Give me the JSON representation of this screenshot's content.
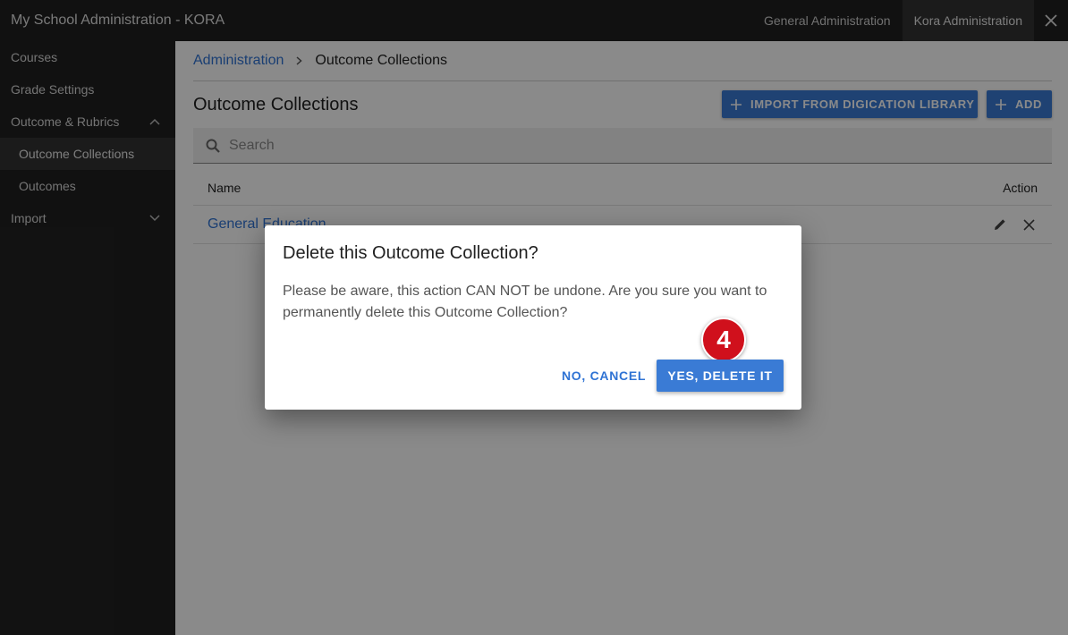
{
  "topbar": {
    "title": "My School Administration - KORA",
    "tabs": [
      {
        "label": "General Administration"
      },
      {
        "label": "Kora Administration"
      }
    ],
    "close_icon": "close-icon"
  },
  "sidebar": {
    "items": [
      {
        "label": "Courses"
      },
      {
        "label": "Grade Settings"
      },
      {
        "label": "Outcome & Rubrics",
        "icon": "chevron-up-icon"
      },
      {
        "label": "Outcome Collections"
      },
      {
        "label": "Outcomes"
      },
      {
        "label": "Import",
        "icon": "chevron-down-icon"
      }
    ]
  },
  "breadcrumb": {
    "root": "Administration",
    "current": "Outcome Collections"
  },
  "page": {
    "title": "Outcome Collections",
    "import_label": "IMPORT FROM DIGICATION LIBRARY",
    "add_label": "ADD"
  },
  "search": {
    "placeholder": "Search",
    "value": ""
  },
  "table": {
    "headers": {
      "name": "Name",
      "action": "Action"
    },
    "rows": [
      {
        "name": "General Education"
      }
    ]
  },
  "dialog": {
    "title": "Delete this Outcome Collection?",
    "body": "Please be aware, this action CAN NOT be undone. Are you sure you want to permanently delete this Outcome Collection?",
    "cancel_label": "NO, CANCEL",
    "confirm_label": "YES, DELETE IT",
    "step_number": "4"
  },
  "colors": {
    "accent": "#3a7bd5",
    "link": "#2f73d4",
    "topbar": "#212121",
    "badge": "#d0101c"
  }
}
